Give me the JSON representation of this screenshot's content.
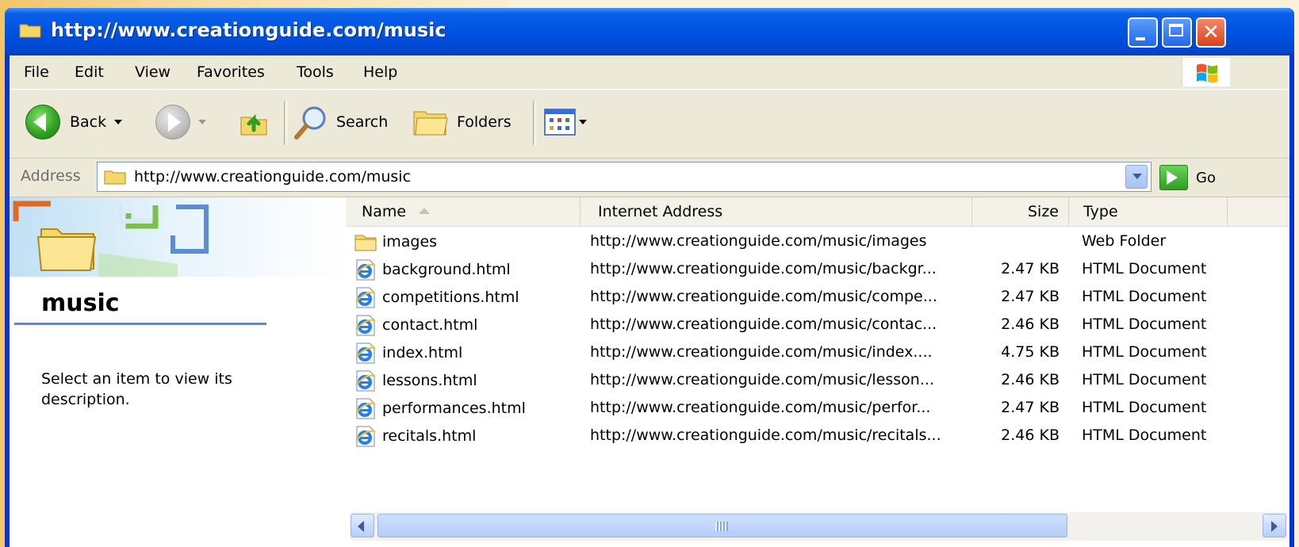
{
  "window": {
    "title": "http://www.creationguide.com/music"
  },
  "menu": [
    "File",
    "Edit",
    "View",
    "Favorites",
    "Tools",
    "Help"
  ],
  "toolbar": {
    "back": "Back",
    "search": "Search",
    "folders": "Folders"
  },
  "address": {
    "label": "Address",
    "value": "http://www.creationguide.com/music",
    "go": "Go"
  },
  "left_pane": {
    "title": "music",
    "description": "Select an item to view its description."
  },
  "columns": {
    "name": "Name",
    "address": "Internet Address",
    "size": "Size",
    "type": "Type"
  },
  "files": [
    {
      "name": "images",
      "url": "http://www.creationguide.com/music/images",
      "size": "",
      "type": "Web Folder",
      "icon": "folder-icon"
    },
    {
      "name": "background.html",
      "url": "http://www.creationguide.com/music/backgr...",
      "size": "2.47 KB",
      "type": "HTML Document",
      "icon": "ie-document-icon"
    },
    {
      "name": "competitions.html",
      "url": "http://www.creationguide.com/music/compe...",
      "size": "2.47 KB",
      "type": "HTML Document",
      "icon": "ie-document-icon"
    },
    {
      "name": "contact.html",
      "url": "http://www.creationguide.com/music/contac...",
      "size": "2.46 KB",
      "type": "HTML Document",
      "icon": "ie-document-icon"
    },
    {
      "name": "index.html",
      "url": "http://www.creationguide.com/music/index....",
      "size": "4.75 KB",
      "type": "HTML Document",
      "icon": "ie-document-icon"
    },
    {
      "name": "lessons.html",
      "url": "http://www.creationguide.com/music/lesson...",
      "size": "2.46 KB",
      "type": "HTML Document",
      "icon": "ie-document-icon"
    },
    {
      "name": "performances.html",
      "url": "http://www.creationguide.com/music/perfor...",
      "size": "2.47 KB",
      "type": "HTML Document",
      "icon": "ie-document-icon"
    },
    {
      "name": "recitals.html",
      "url": "http://www.creationguide.com/music/recitals...",
      "size": "2.46 KB",
      "type": "HTML Document",
      "icon": "ie-document-icon"
    }
  ],
  "colors": {
    "title_bar": "#0053e1",
    "chrome": "#ece9d8",
    "close_button": "#d8411c",
    "rule": "#5a86d8"
  }
}
